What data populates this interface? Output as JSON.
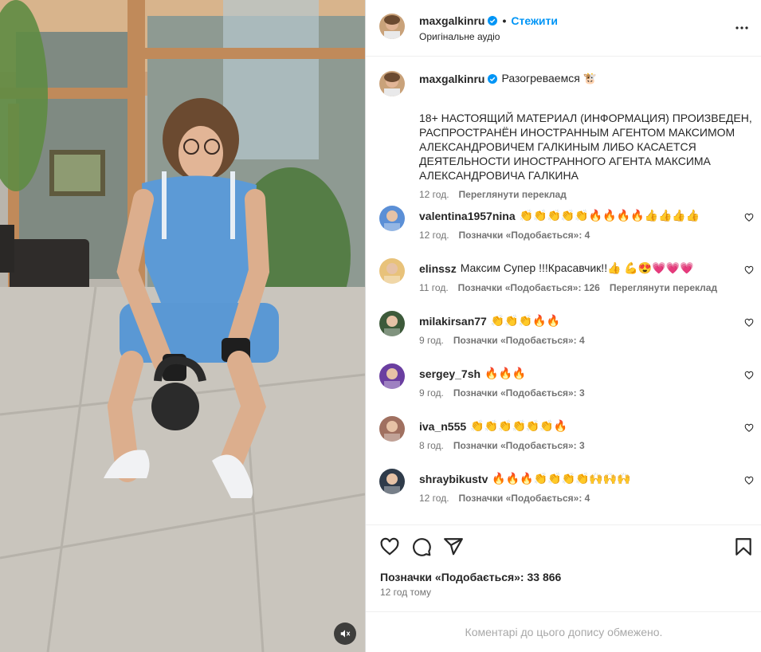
{
  "post": {
    "username": "maxgalkinru",
    "follow_label": "Стежити",
    "separator": "•",
    "audio": "Оригінальне аудіо"
  },
  "caption": {
    "username": "maxgalkinru",
    "title": "Разогреваемся 🐮",
    "body": "18+ НАСТОЯЩИЙ МАТЕРИАЛ (ИНФОРМАЦИЯ) ПРОИЗВЕДЕН, РАСПРОСТРАНЁН ИНОСТРАННЫМ АГЕНТОМ МАКСИМОМ АЛЕКСАНДРОВИЧЕМ ГАЛКИНЫМ ЛИБО КАСАЕТСЯ ДЕЯТЕЛЬНОСТИ ИНОСТРАННОГО АГЕНТА МАКСИМА АЛЕКСАНДРОВИЧА ГАЛКИНА",
    "time": "12 год.",
    "translate": "Переглянути переклад"
  },
  "comments": [
    {
      "username": "valentina1957nina",
      "text": "👏👏👏👏👏🔥🔥🔥🔥👍👍👍👍",
      "time": "12 год.",
      "likes": "Позначки «Подобається»: 4",
      "avatar_color": "#5b8fd6"
    },
    {
      "username": "elinssz",
      "text": "Максим Супер !!!Красавчик!!👍 💪😍💗💗💗",
      "time": "11 год.",
      "likes": "Позначки «Подобається»: 126",
      "translate": "Переглянути переклад",
      "avatar_color": "#e8c27a"
    },
    {
      "username": "milakirsan77",
      "text": "👏👏👏🔥🔥",
      "time": "9 год.",
      "likes": "Позначки «Подобається»: 4",
      "avatar_color": "#3d5a3a"
    },
    {
      "username": "sergey_7sh",
      "text": "🔥🔥🔥",
      "time": "9 год.",
      "likes": "Позначки «Подобається»: 3",
      "avatar_color": "#6a3ea0"
    },
    {
      "username": "iva_n555",
      "text": "👏👏👏👏👏👏🔥",
      "time": "8 год.",
      "likes": "Позначки «Подобається»: 3",
      "avatar_color": "#a07060"
    },
    {
      "username": "shraybikustv",
      "text": "🔥🔥🔥👏👏👏👏🙌🙌🙌",
      "time": "12 год.",
      "likes": "Позначки «Подобається»: 4",
      "avatar_color": "#2f3b4a"
    }
  ],
  "actions": {
    "likes": "Позначки «Подобається»: 33 866",
    "posted": "12 год тому"
  },
  "comments_limited": "Коментарі до цього допису обмежено.",
  "colors": {
    "accent": "#0095f6",
    "verified": "#0095f6",
    "secondary_text": "#737373"
  },
  "icons": [
    "verified-badge-icon",
    "more-options-icon",
    "heart-icon",
    "comment-icon",
    "share-icon",
    "bookmark-icon",
    "muted-speaker-icon"
  ]
}
